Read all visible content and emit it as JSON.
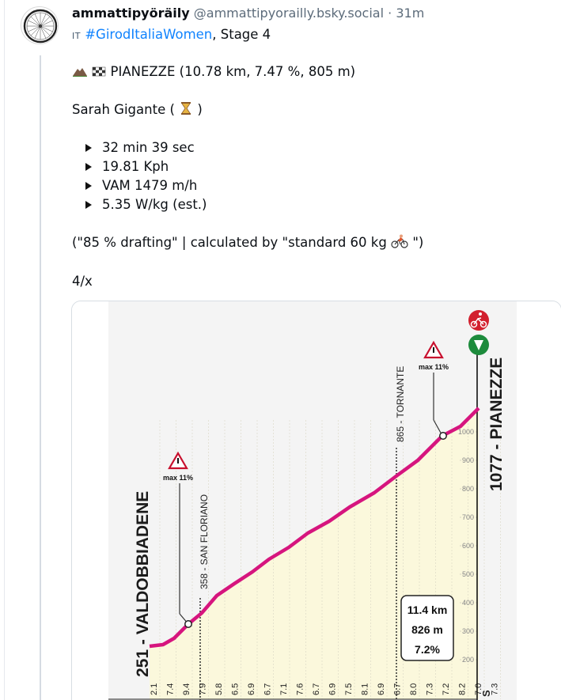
{
  "post": {
    "display_name": "ammattipyöräily",
    "handle": "@ammattipyorailly.bsky.social",
    "separator": "·",
    "time": "31m",
    "lang": "IT",
    "hashtag": "#GirodItaliaWomen",
    "stage": ", Stage 4",
    "climb_line": "PIANEZZE (10.78 km, 7.47 %, 805 m)",
    "rider_name": "Sarah Gigante (",
    "rider_close": ")",
    "stats": [
      "32 min 39 sec",
      "19.81 Kph",
      "VAM 1479 m/h",
      "5.35 W/kg (est.)"
    ],
    "note_a": "(\"85 % drafting\" | calculated by \"standard 60 kg ",
    "note_b": "\")",
    "counter": "4/x"
  },
  "profile": {
    "start_label": "251 - VALDOBBIADENE",
    "finish_label": "1077 - PIANEZZE",
    "checkpoint_1": "358 - SAN FLORIANO",
    "checkpoint_2": "865 - TORNANTE",
    "max_1": "max 11%",
    "max_2": "max 11%",
    "info_distance": "11.4 km",
    "info_gain": "826 m",
    "info_gradient": "7.2%",
    "elevation_ticks": [
      "1000",
      "900",
      "800",
      "700",
      "600",
      "500",
      "400",
      "300",
      "200"
    ],
    "km_gradients": [
      "2.1",
      "7.4",
      "9.4",
      "7.9",
      "5.8",
      "6.5",
      "6.9",
      "6.7",
      "7.1",
      "7.6",
      "6.7",
      "6.9",
      "7.5",
      "8.1",
      "6.9",
      "6.7",
      "8.0",
      "7.3",
      "7.2",
      "8.2",
      "7.0",
      "7.3"
    ],
    "colors": {
      "profile_line": "#d6157e",
      "fill": "#fbf8dc",
      "grid": "#d9d6c4",
      "icon_red": "#d2202e",
      "icon_green": "#1d8b3c"
    }
  }
}
